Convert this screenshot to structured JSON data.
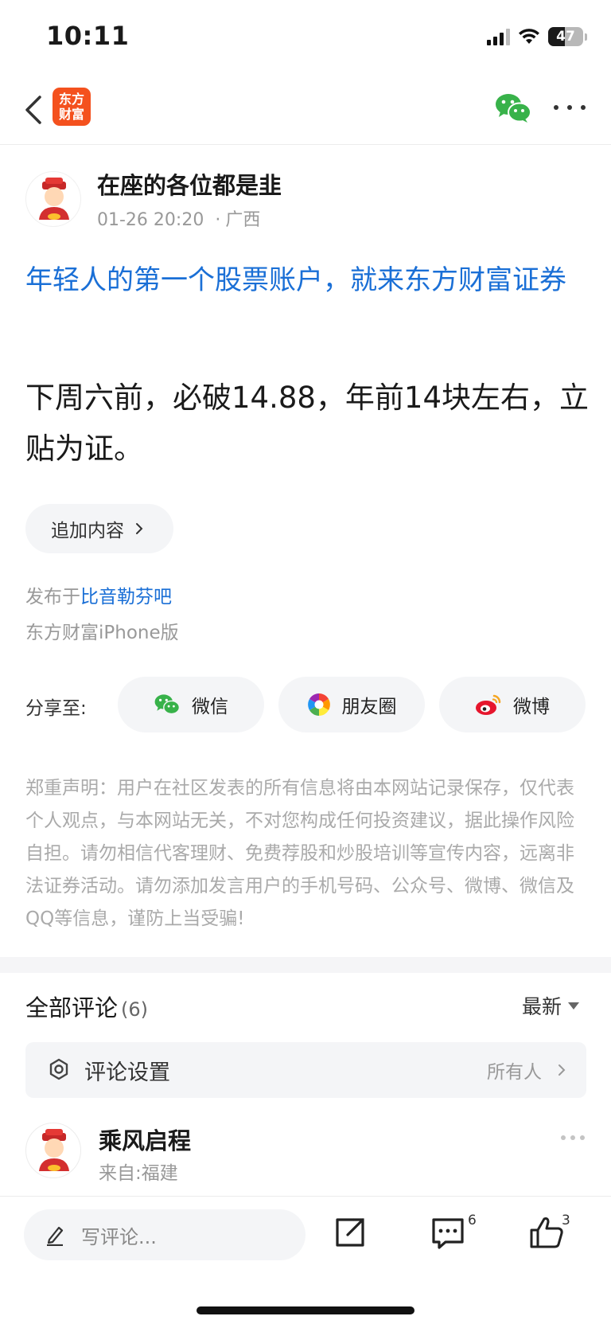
{
  "status": {
    "time": "10:11",
    "battery": "47",
    "battery_level": 0.47
  },
  "nav": {
    "logo_line1": "东方",
    "logo_line2": "财富",
    "brand_color": "#f4511e"
  },
  "author": {
    "name": "在座的各位都是韭",
    "date": "01-26 20:20",
    "location": "广西"
  },
  "post": {
    "ad_text": "年轻人的第一个股票账户，就来东方财富证券",
    "body": "下周六前，必破14.88，年前14块左右，立贴为证。",
    "append_label": "追加内容",
    "publish_prefix": "发布于",
    "forum": "比音勒芬吧",
    "device": "东方财富iPhone版"
  },
  "share": {
    "label": "分享至:",
    "wechat": "微信",
    "moments": "朋友圈",
    "weibo": "微博"
  },
  "disclaimer": "郑重声明：用户在社区发表的所有信息将由本网站记录保存，仅代表个人观点，与本网站无关，不对您构成任何投资建议，据此操作风险自担。请勿相信代客理财、免费荐股和炒股培训等宣传内容，远离非法证券活动。请勿添加发言用户的手机号码、公众号、微博、微信及QQ等信息，谨防上当受骗!",
  "comments": {
    "title": "全部评论",
    "count": "(6)",
    "sort": "最新",
    "settings_label": "评论设置",
    "settings_value": "所有人",
    "items": [
      {
        "user": "乘风启程",
        "location": "来自:福建"
      }
    ]
  },
  "bottom": {
    "write_placeholder": "写评论...",
    "comment_count": "6",
    "like_count": "3"
  },
  "colors": {
    "link_blue": "#1a6fd6",
    "wechat_green": "#38b24a",
    "weibo_red": "#e6162d"
  }
}
